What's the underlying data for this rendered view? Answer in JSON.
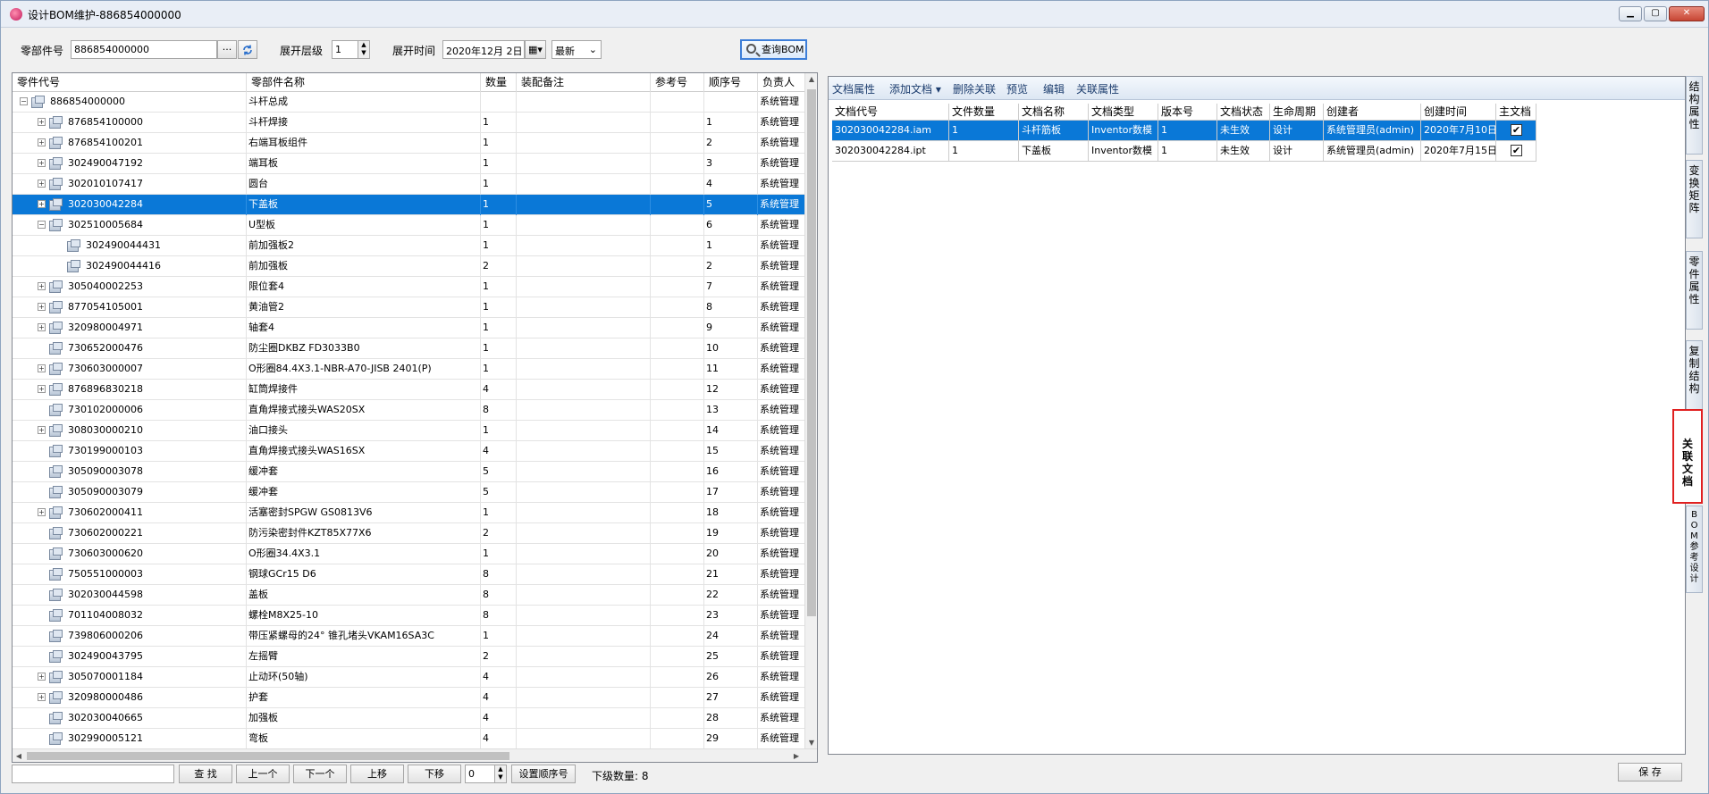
{
  "window": {
    "title": "设计BOM维护-886854000000",
    "buttons": [
      "▁",
      "▢",
      "✕"
    ]
  },
  "toolbar": {
    "part_no_label": "零部件号",
    "part_no_value": "886854000000",
    "browse_label": "···",
    "expand_level_label": "展开层级",
    "expand_level_value": "1",
    "expand_time_label": "展开时间",
    "expand_time_value": "2020年12月 2日",
    "version_value": "最新",
    "query_label": "查询BOM"
  },
  "tree": {
    "columns": [
      "零件代号",
      "零部件名称",
      "数量",
      "装配备注",
      "参考号",
      "顺序号",
      "负责人"
    ],
    "rows": [
      {
        "level": 0,
        "exp": "−",
        "code": "886854000000",
        "name": "斗杆总成",
        "qty": "",
        "seq": "",
        "owner": "系统管理",
        "selected": false
      },
      {
        "level": 1,
        "exp": "+",
        "code": "876854100000",
        "name": "斗杆焊接",
        "qty": "1",
        "seq": "1",
        "owner": "系统管理",
        "selected": false
      },
      {
        "level": 1,
        "exp": "+",
        "code": "876854100201",
        "name": "右端耳板组件",
        "qty": "1",
        "seq": "2",
        "owner": "系统管理",
        "selected": false
      },
      {
        "level": 1,
        "exp": "+",
        "code": "302490047192",
        "name": "端耳板",
        "qty": "1",
        "seq": "3",
        "owner": "系统管理",
        "selected": false
      },
      {
        "level": 1,
        "exp": "+",
        "code": "302010107417",
        "name": "圆台",
        "qty": "1",
        "seq": "4",
        "owner": "系统管理",
        "selected": false
      },
      {
        "level": 1,
        "exp": "+",
        "code": "302030042284",
        "name": "下盖板",
        "qty": "1",
        "seq": "5",
        "owner": "系统管理",
        "selected": true
      },
      {
        "level": 1,
        "exp": "−",
        "code": "302510005684",
        "name": "U型板",
        "qty": "1",
        "seq": "6",
        "owner": "系统管理",
        "selected": false
      },
      {
        "level": 2,
        "exp": "",
        "code": "302490044431",
        "name": "前加强板2",
        "qty": "1",
        "seq": "1",
        "owner": "系统管理",
        "selected": false
      },
      {
        "level": 2,
        "exp": "",
        "code": "302490044416",
        "name": "前加强板",
        "qty": "2",
        "seq": "2",
        "owner": "系统管理",
        "selected": false
      },
      {
        "level": 1,
        "exp": "+",
        "code": "305040002253",
        "name": "限位套4",
        "qty": "1",
        "seq": "7",
        "owner": "系统管理",
        "selected": false
      },
      {
        "level": 1,
        "exp": "+",
        "code": "877054105001",
        "name": "黄油管2",
        "qty": "1",
        "seq": "8",
        "owner": "系统管理",
        "selected": false
      },
      {
        "level": 1,
        "exp": "+",
        "code": "320980004971",
        "name": "轴套4",
        "qty": "1",
        "seq": "9",
        "owner": "系统管理",
        "selected": false
      },
      {
        "level": 1,
        "exp": "",
        "code": "730652000476",
        "name": "防尘圈DKBZ FD3033B0",
        "qty": "1",
        "seq": "10",
        "owner": "系统管理",
        "selected": false
      },
      {
        "level": 1,
        "exp": "+",
        "code": "730603000007",
        "name": "O形圈84.4X3.1-NBR-A70-JISB 2401(P)",
        "qty": "1",
        "seq": "11",
        "owner": "系统管理",
        "selected": false
      },
      {
        "level": 1,
        "exp": "+",
        "code": "876896830218",
        "name": "缸筒焊接件",
        "qty": "4",
        "seq": "12",
        "owner": "系统管理",
        "selected": false
      },
      {
        "level": 1,
        "exp": "",
        "code": "730102000006",
        "name": "直角焊接式接头WAS20SX",
        "qty": "8",
        "seq": "13",
        "owner": "系统管理",
        "selected": false
      },
      {
        "level": 1,
        "exp": "+",
        "code": "308030000210",
        "name": "油口接头",
        "qty": "1",
        "seq": "14",
        "owner": "系统管理",
        "selected": false
      },
      {
        "level": 1,
        "exp": "",
        "code": "730199000103",
        "name": "直角焊接式接头WAS16SX",
        "qty": "4",
        "seq": "15",
        "owner": "系统管理",
        "selected": false
      },
      {
        "level": 1,
        "exp": "",
        "code": "305090003078",
        "name": "缓冲套",
        "qty": "5",
        "seq": "16",
        "owner": "系统管理",
        "selected": false
      },
      {
        "level": 1,
        "exp": "",
        "code": "305090003079",
        "name": "缓冲套",
        "qty": "5",
        "seq": "17",
        "owner": "系统管理",
        "selected": false
      },
      {
        "level": 1,
        "exp": "+",
        "code": "730602000411",
        "name": "活塞密封SPGW GS0813V6",
        "qty": "1",
        "seq": "18",
        "owner": "系统管理",
        "selected": false
      },
      {
        "level": 1,
        "exp": "",
        "code": "730602000221",
        "name": "防污染密封件KZT85X77X6",
        "qty": "2",
        "seq": "19",
        "owner": "系统管理",
        "selected": false
      },
      {
        "level": 1,
        "exp": "",
        "code": "730603000620",
        "name": "O形圈34.4X3.1",
        "qty": "1",
        "seq": "20",
        "owner": "系统管理",
        "selected": false
      },
      {
        "level": 1,
        "exp": "",
        "code": "750551000003",
        "name": "钢球GCr15 D6",
        "qty": "8",
        "seq": "21",
        "owner": "系统管理",
        "selected": false
      },
      {
        "level": 1,
        "exp": "",
        "code": "302030044598",
        "name": "盖板",
        "qty": "8",
        "seq": "22",
        "owner": "系统管理",
        "selected": false
      },
      {
        "level": 1,
        "exp": "",
        "code": "701104008032",
        "name": "螺栓M8X25-10",
        "qty": "8",
        "seq": "23",
        "owner": "系统管理",
        "selected": false
      },
      {
        "level": 1,
        "exp": "",
        "code": "739806000206",
        "name": "带压紧螺母的24° 锥孔堵头VKAM16SA3C",
        "qty": "1",
        "seq": "24",
        "owner": "系统管理",
        "selected": false
      },
      {
        "level": 1,
        "exp": "",
        "code": "302490043795",
        "name": "左摇臂",
        "qty": "2",
        "seq": "25",
        "owner": "系统管理",
        "selected": false
      },
      {
        "level": 1,
        "exp": "+",
        "code": "305070001184",
        "name": "止动环(50轴)",
        "qty": "4",
        "seq": "26",
        "owner": "系统管理",
        "selected": false
      },
      {
        "level": 1,
        "exp": "+",
        "code": "320980000486",
        "name": "护套",
        "qty": "4",
        "seq": "27",
        "owner": "系统管理",
        "selected": false
      },
      {
        "level": 1,
        "exp": "",
        "code": "302030040665",
        "name": "加强板",
        "qty": "4",
        "seq": "28",
        "owner": "系统管理",
        "selected": false
      },
      {
        "level": 1,
        "exp": "",
        "code": "302990005121",
        "name": "弯板",
        "qty": "4",
        "seq": "29",
        "owner": "系统管理",
        "selected": false
      }
    ]
  },
  "docs": {
    "toolbar": [
      "文档属性",
      "添加文档 ▾",
      "删除关联",
      "预览",
      "编辑",
      "关联属性"
    ],
    "columns": [
      "文档代号",
      "文件数量",
      "文档名称",
      "文档类型",
      "版本号",
      "文档状态",
      "生命周期",
      "创建者",
      "创建时间",
      "主文档"
    ],
    "rows": [
      {
        "code": "302030042284.iam",
        "count": "1",
        "name": "斗杆筋板",
        "type": "Inventor数模",
        "ver": "1",
        "status": "未生效",
        "life": "设计",
        "creator": "系统管理员(admin)",
        "time": "2020年7月10日",
        "main": "✔",
        "selected": true
      },
      {
        "code": "302030042284.ipt",
        "count": "1",
        "name": "下盖板",
        "type": "Inventor数模",
        "ver": "1",
        "status": "未生效",
        "life": "设计",
        "creator": "系统管理员(admin)",
        "time": "2020年7月15日",
        "main": "✔",
        "selected": false
      }
    ]
  },
  "side_tabs": [
    "结构属性",
    "变换矩阵",
    "零件属性",
    "复制结构",
    "关联文档",
    "BOM参考设计"
  ],
  "bottom": {
    "search_value": "",
    "find_label": "查 找",
    "prev_label": "上一个",
    "next_label": "下一个",
    "up_label": "上移",
    "down_label": "下移",
    "seq_value": "0",
    "set_seq_label": "设置顺序号",
    "child_count_label": "下级数量: 8",
    "save_label": "保 存"
  }
}
